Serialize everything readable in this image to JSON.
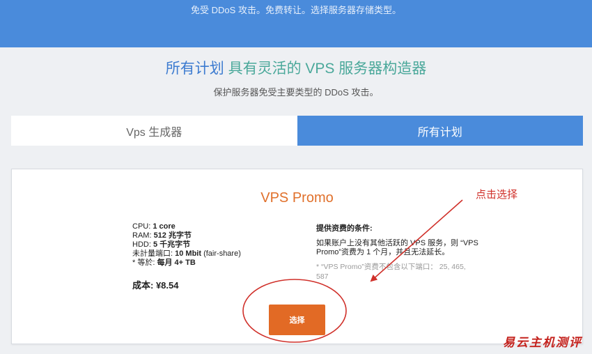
{
  "hero": {
    "text": "免受 DDoS 攻击。免费转让。选择服务器存储类型。"
  },
  "header": {
    "title_part1": "所有计划",
    "title_part2": " 具有灵活的 VPS 服务器构造器",
    "subtitle": "保护服务器免受主要类型的 DDoS 攻击。"
  },
  "tabs": {
    "builder": "Vps 生成器",
    "all_plans": "所有计划"
  },
  "plan": {
    "name": "VPS Promo",
    "cpu_label": "CPU: ",
    "cpu_value": "1 core",
    "ram_label": "RAM: ",
    "ram_value": "512 兆字节",
    "hdd_label": "HDD: ",
    "hdd_value": "5 千兆字节",
    "port_label": "未計量端口: ",
    "port_value": "10 Mbit",
    "port_suffix": " (fair-share)",
    "traffic_label": "* 等於: ",
    "traffic_value": "每月 4+ TB",
    "price_label": "成本: ",
    "price_value": "¥8.54",
    "conditions_title": "提供资费的条件:",
    "conditions_text": "如果账户上没有其他活跃的 VPS 服务，则 “VPS Promo”资费为 1 个月，并且无法延长。",
    "conditions_note": "* “VPS Promo”资费不包含以下端口：  25, 465, 587",
    "select_label": "选择"
  },
  "annotation": {
    "label": "点击选择"
  },
  "watermark": {
    "text": "易云主机测评"
  },
  "colors": {
    "hero_blue": "#4a8bdb",
    "title_blue": "#3c7bd0",
    "title_teal": "#4aa89a",
    "plan_orange": "#e0702b",
    "button_orange": "#e26a25",
    "annotation_red": "#d0302a"
  }
}
